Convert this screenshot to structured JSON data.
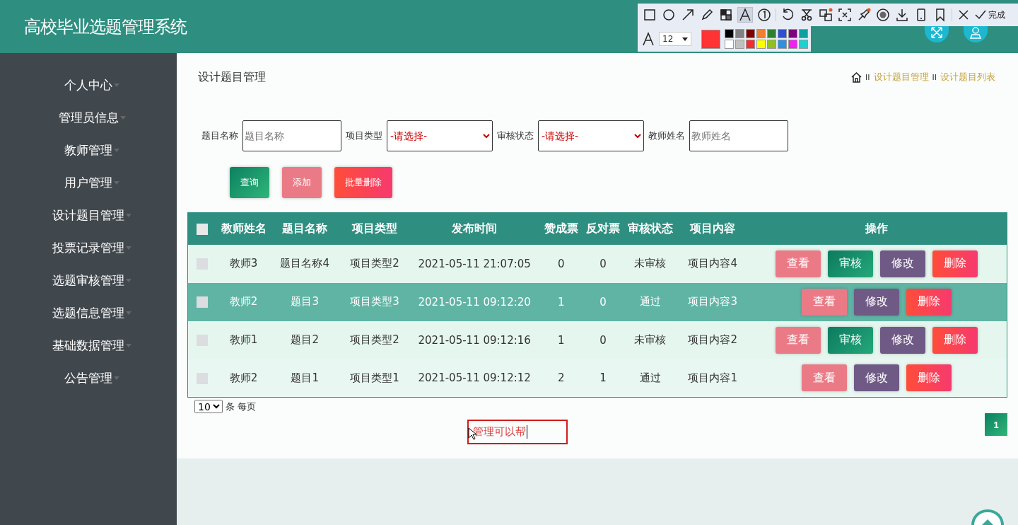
{
  "header": {
    "title": "高校毕业选题管理系统"
  },
  "sidebar": {
    "items": [
      {
        "label": "个人中心"
      },
      {
        "label": "管理员信息"
      },
      {
        "label": "教师管理"
      },
      {
        "label": "用户管理"
      },
      {
        "label": "设计题目管理"
      },
      {
        "label": "投票记录管理"
      },
      {
        "label": "选题审核管理"
      },
      {
        "label": "选题信息管理"
      },
      {
        "label": "基础数据管理"
      },
      {
        "label": "公告管理"
      }
    ]
  },
  "page_title": "设计题目管理",
  "breadcrumb": [
    {
      "separator": "II",
      "label": "设计题目管理"
    },
    {
      "separator": "II",
      "label": "设计题目列表"
    }
  ],
  "search": {
    "fields": [
      {
        "label": "题目名称",
        "kind": "input",
        "placeholder": "题目名称"
      },
      {
        "label": "项目类型",
        "kind": "select",
        "value": "-请选择-"
      },
      {
        "label": "审核状态",
        "kind": "select",
        "value": "-请选择-"
      },
      {
        "label": "教师姓名",
        "kind": "input",
        "placeholder": "教师姓名"
      }
    ],
    "buttons": [
      {
        "label": "查询",
        "kind": "query"
      },
      {
        "label": "添加",
        "kind": "add"
      },
      {
        "label": "批量删除",
        "kind": "delete"
      }
    ]
  },
  "table": {
    "select_all_checked": false,
    "columns": [
      "教师姓名",
      "题目名称",
      "项目类型",
      "发布时间",
      "赞成票",
      "反对票",
      "审核状态",
      "项目内容",
      "操作"
    ],
    "rows": [
      {
        "selected": false,
        "checked": false,
        "cells": [
          "教师3",
          "题目名称4",
          "项目类型2",
          "2021-05-11 21:07:05",
          "0",
          "0",
          "未审核",
          "项目内容4"
        ],
        "actions": [
          {
            "label": "查看",
            "kind": "view"
          },
          {
            "label": "审核",
            "kind": "review"
          },
          {
            "label": "修改",
            "kind": "edit"
          },
          {
            "label": "删除",
            "kind": "delete"
          }
        ]
      },
      {
        "selected": true,
        "checked": false,
        "cells": [
          "教师2",
          "题目3",
          "项目类型3",
          "2021-05-11 09:12:20",
          "1",
          "0",
          "通过",
          "项目内容3"
        ],
        "actions": [
          {
            "label": "查看",
            "kind": "view"
          },
          {
            "label": "修改",
            "kind": "edit"
          },
          {
            "label": "删除",
            "kind": "delete"
          }
        ]
      },
      {
        "selected": false,
        "checked": false,
        "cells": [
          "教师1",
          "题目2",
          "项目类型2",
          "2021-05-11 09:12:16",
          "1",
          "0",
          "未审核",
          "项目内容2"
        ],
        "actions": [
          {
            "label": "查看",
            "kind": "view"
          },
          {
            "label": "审核",
            "kind": "review"
          },
          {
            "label": "修改",
            "kind": "edit"
          },
          {
            "label": "删除",
            "kind": "delete"
          }
        ]
      },
      {
        "selected": false,
        "checked": false,
        "cells": [
          "教师2",
          "题目1",
          "项目类型1",
          "2021-05-11 09:12:12",
          "2",
          "1",
          "通过",
          "项目内容1"
        ],
        "actions": [
          {
            "label": "查看",
            "kind": "view"
          },
          {
            "label": "修改",
            "kind": "edit"
          },
          {
            "label": "删除",
            "kind": "delete"
          }
        ]
      }
    ]
  },
  "pagination": {
    "page_size": "10",
    "page_size_label": "条 每页",
    "pages": [
      {
        "label": "1",
        "selected": true
      }
    ]
  },
  "annotation": {
    "text": "管理可以帮"
  },
  "capture_toolbar": {
    "tools": [
      {
        "kind": "rect",
        "selected": false
      },
      {
        "kind": "ellipse",
        "selected": false
      },
      {
        "kind": "arrow",
        "selected": false
      },
      {
        "kind": "pencil",
        "selected": false
      },
      {
        "kind": "mosaic",
        "selected": false
      },
      {
        "kind": "text",
        "selected": true
      },
      {
        "kind": "number",
        "selected": false
      },
      {
        "kind": "undo",
        "selected": false
      },
      {
        "kind": "cut",
        "selected": false
      },
      {
        "kind": "translate",
        "selected": false
      },
      {
        "kind": "ocr",
        "selected": false
      },
      {
        "kind": "pin",
        "selected": false
      },
      {
        "kind": "record",
        "selected": false
      },
      {
        "kind": "download",
        "selected": false
      },
      {
        "kind": "phone",
        "selected": false
      },
      {
        "kind": "bookmark",
        "selected": false
      },
      {
        "kind": "close",
        "selected": false
      }
    ],
    "done_label": "完成",
    "font_size": "12",
    "current_swatch": {
      "color": "#ff3333"
    },
    "palette": [
      {
        "color": "#000000"
      },
      {
        "color": "#808080"
      },
      {
        "color": "#800000"
      },
      {
        "color": "#f08030"
      },
      {
        "color": "#2e8030"
      },
      {
        "color": "#3050d0"
      },
      {
        "color": "#800080"
      },
      {
        "color": "#10a0a0"
      },
      {
        "color": "#ffffff"
      },
      {
        "color": "#c0c0c0"
      },
      {
        "color": "#f03030"
      },
      {
        "color": "#ffff00"
      },
      {
        "color": "#90c020"
      },
      {
        "color": "#3090e0"
      },
      {
        "color": "#f020f0"
      },
      {
        "color": "#20d0d0"
      }
    ]
  }
}
